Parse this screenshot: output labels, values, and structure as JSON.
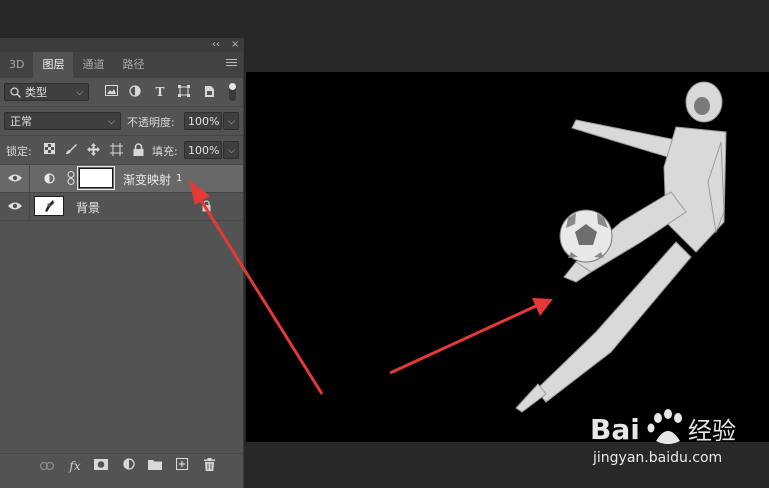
{
  "panel": {
    "collapse_glyph": "‹‹",
    "close_glyph": "×",
    "tabs": [
      {
        "label": "3D"
      },
      {
        "label": "图层"
      },
      {
        "label": "通道"
      },
      {
        "label": "路径"
      }
    ],
    "filter_kind": "类型",
    "blend_mode": "正常",
    "opacity_label": "不透明度:",
    "opacity_value": "100%",
    "lock_label": "锁定:",
    "fill_label": "填充:",
    "fill_value": "100%",
    "layers": [
      {
        "name": "渐变映射",
        "badge": "1",
        "visible": true,
        "selected": true,
        "kind": "gradient-map-adjustment"
      },
      {
        "name": "背景",
        "visible": true,
        "selected": false,
        "kind": "image",
        "locked": true
      }
    ],
    "footer_icons": [
      "link-layers-icon",
      "fx-icon",
      "add-mask-icon",
      "adjustment-layer-icon",
      "group-folder-icon",
      "new-layer-icon",
      "trash-icon"
    ],
    "fx_glyph": "fx"
  },
  "watermark": {
    "brand": "Bai",
    "brand_suffix": "经验",
    "url": "jingyan.baidu.com"
  },
  "colors": {
    "arrow": "#e53935",
    "panel_bg": "#535353",
    "app_bg": "#282828",
    "selected_row": "#686868"
  }
}
